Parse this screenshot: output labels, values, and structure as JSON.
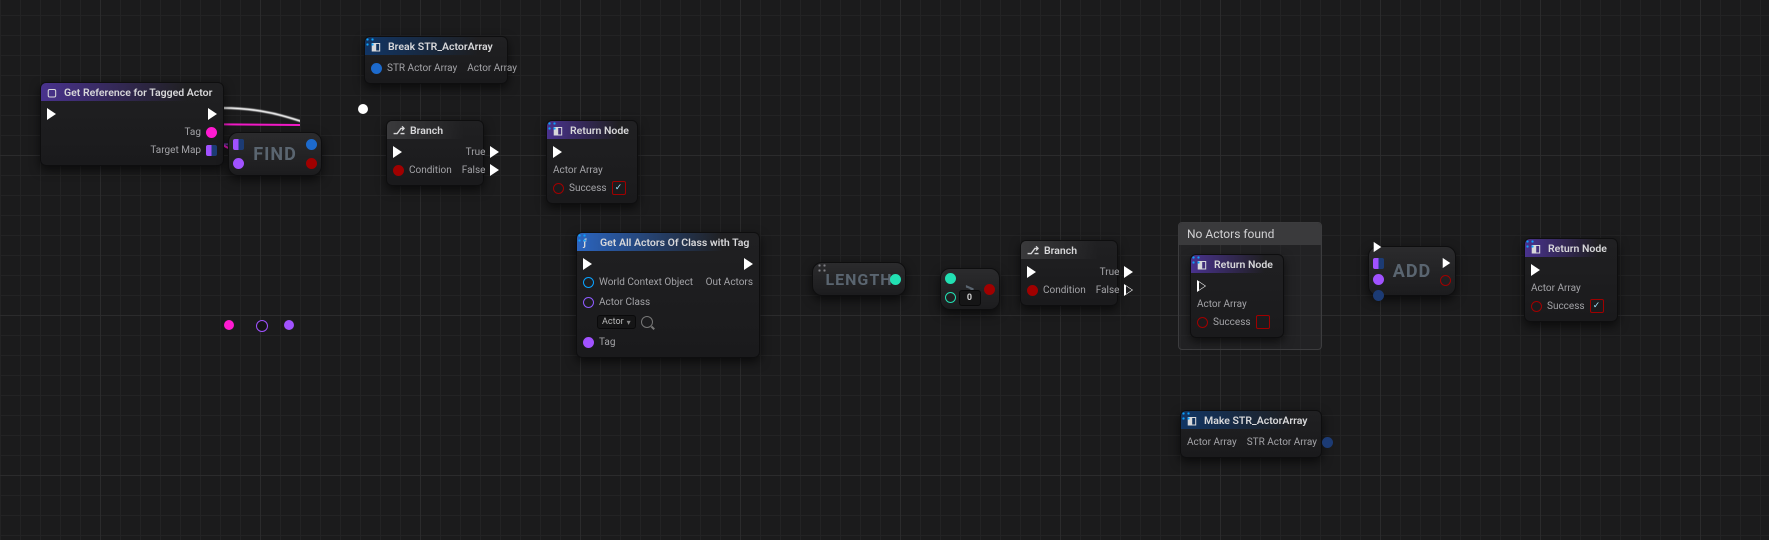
{
  "nodes": {
    "get_ref": {
      "title": "Get Reference for Tagged Actor",
      "pins": {
        "tag": "Tag",
        "target_map": "Target Map"
      }
    },
    "break": {
      "title": "Break STR_ActorArray",
      "pins": {
        "in": "STR Actor Array",
        "out": "Actor Array"
      }
    },
    "branch1": {
      "title": "Branch",
      "pins": {
        "cond": "Condition",
        "t": "True",
        "f": "False"
      }
    },
    "return1": {
      "title": "Return Node",
      "pins": {
        "arr": "Actor Array",
        "success": "Success"
      },
      "checked": true
    },
    "getall": {
      "title": "Get All Actors Of Class with Tag",
      "pins": {
        "wco": "World Context Object",
        "cls": "Actor Class",
        "cls_val": "Actor",
        "tag": "Tag",
        "out": "Out Actors"
      }
    },
    "length": {
      "label": "LENGTH"
    },
    "greater": {
      "label": ">",
      "value": "0"
    },
    "branch2": {
      "title": "Branch",
      "pins": {
        "cond": "Condition",
        "t": "True",
        "f": "False"
      }
    },
    "comment": {
      "title": "No Actors found"
    },
    "return2": {
      "title": "Return Node",
      "pins": {
        "arr": "Actor Array",
        "success": "Success"
      },
      "checked": false
    },
    "add": {
      "label": "ADD"
    },
    "return3": {
      "title": "Return Node",
      "pins": {
        "arr": "Actor Array",
        "success": "Success"
      },
      "checked": true
    },
    "make": {
      "title": "Make STR_ActorArray",
      "pins": {
        "in": "Actor Array",
        "out": "STR Actor Array"
      }
    },
    "find": {
      "label": "FIND"
    }
  }
}
